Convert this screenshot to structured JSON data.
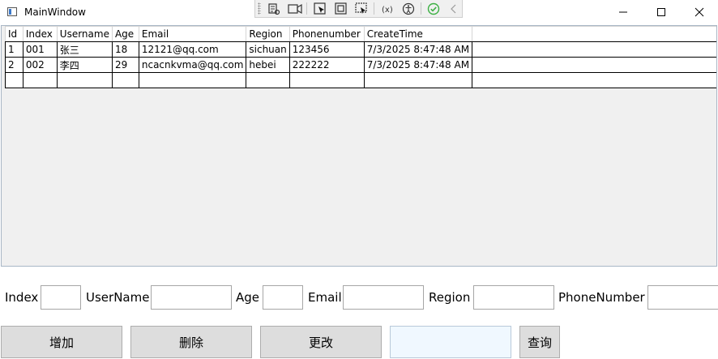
{
  "window": {
    "title": "MainWindow",
    "minimize_glyph": "—",
    "maximize_glyph": "☐",
    "close_glyph": "✕"
  },
  "debug_toolbar": {
    "icons": [
      "select-element-icon",
      "record-icon",
      "pointer-select-icon",
      "display-adorners-icon",
      "track-focus-icon",
      "binding-failures-icon",
      "accessibility-icon",
      "check-icon",
      "collapse-chevron-icon"
    ],
    "accent": "#3cb043"
  },
  "grid": {
    "columns": [
      "Id",
      "Index",
      "Username",
      "Age",
      "Email",
      "Region",
      "Phonenumber",
      "CreateTime"
    ],
    "rows": [
      [
        "1",
        "001",
        "张三",
        "18",
        "12121@qq.com",
        "sichuan",
        "123456",
        "7/3/2025 8:47:48 AM"
      ],
      [
        "2",
        "002",
        "李四",
        "29",
        "ncacnkvma@qq.com",
        "hebei",
        "222222",
        "7/3/2025 8:47:48 AM"
      ]
    ]
  },
  "form": {
    "index_label": "Index",
    "username_label": "UserName",
    "age_label": "Age",
    "email_label": "Email",
    "region_label": "Region",
    "phonenumber_label": "PhoneNumber"
  },
  "buttons": {
    "add": "增加",
    "delete": "删除",
    "update": "更改",
    "query": "查询"
  }
}
